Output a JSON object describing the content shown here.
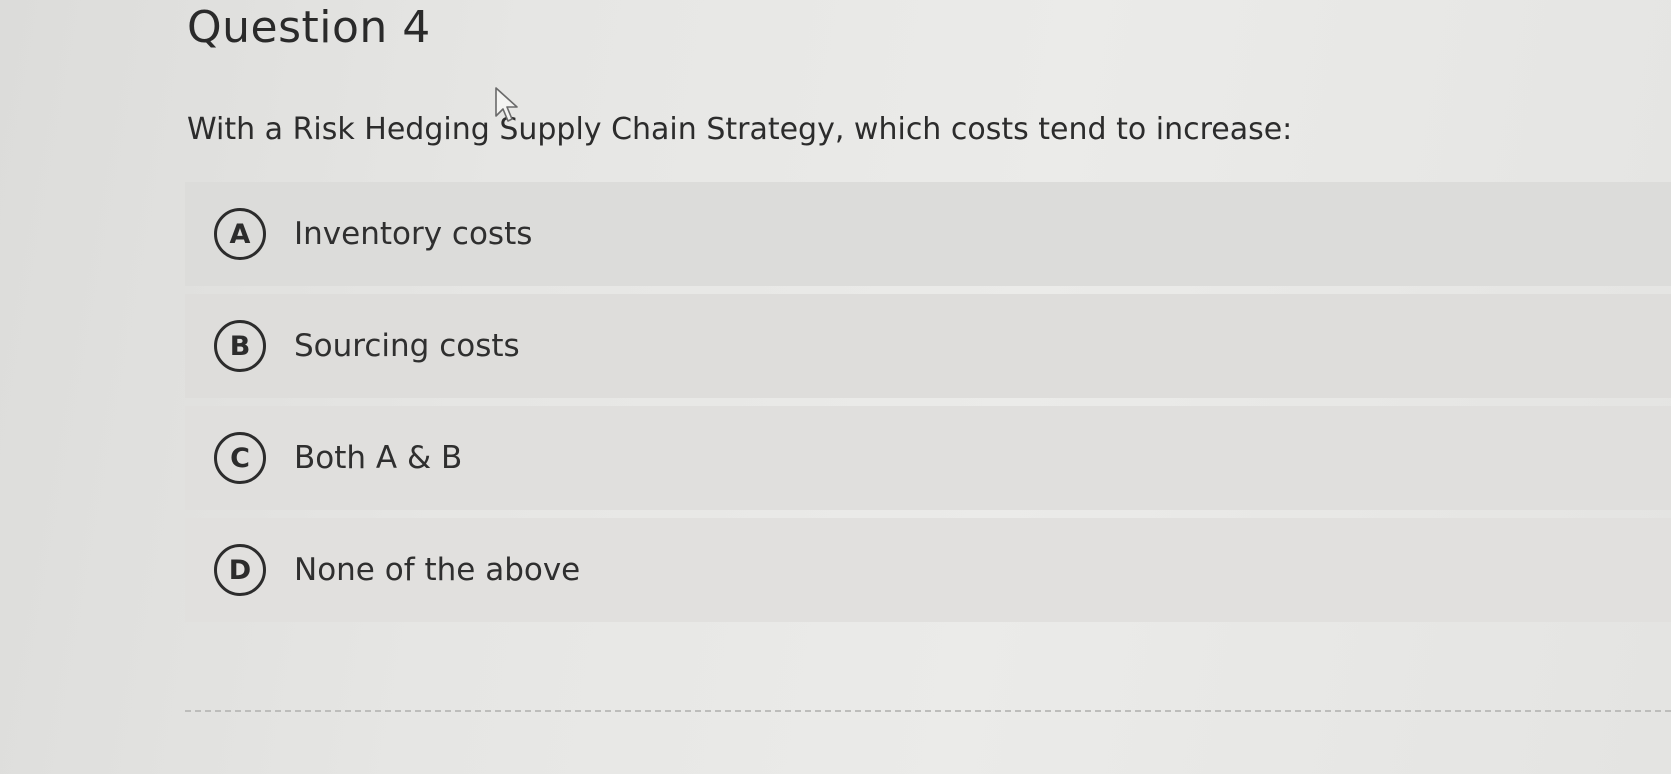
{
  "question": {
    "title": "Question 4",
    "text": "With a Risk Hedging Supply Chain Strategy, which costs tend to increase:"
  },
  "options": [
    {
      "letter": "A",
      "label": "Inventory costs"
    },
    {
      "letter": "B",
      "label": "Sourcing costs"
    },
    {
      "letter": "C",
      "label": "Both A & B"
    },
    {
      "letter": "D",
      "label": "None of the above"
    }
  ],
  "icons": {
    "cursor": "mouse-pointer-icon"
  }
}
